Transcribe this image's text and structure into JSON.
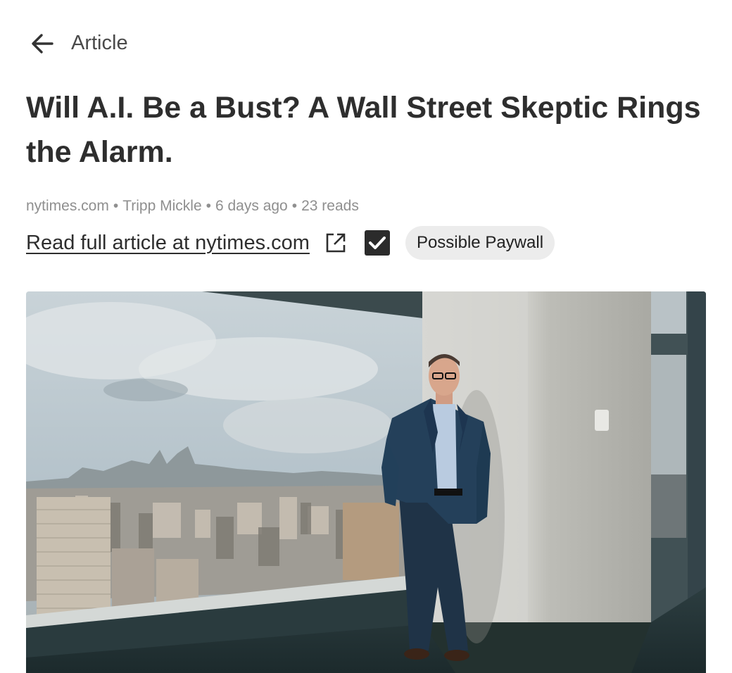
{
  "topbar": {
    "back_icon": "arrow-left-icon",
    "title": "Article"
  },
  "article": {
    "title": "Will A.I. Be a Bust? A Wall Street Skeptic Rings the Alarm.",
    "meta": {
      "source": "nytimes.com",
      "author": "Tripp Mickle",
      "time": "6 days ago",
      "reads": "23 reads",
      "separator": "•"
    },
    "read_full_label": "Read full article at nytimes.com",
    "external_icon": "external-link-icon",
    "checkbox_checked": true,
    "paywall_label": "Possible Paywall",
    "image_description": "Man in a navy suit leaning against a white column beside a window overlooking the New York City skyline"
  },
  "colors": {
    "text": "#2e2e2e",
    "meta": "#8f8f8f",
    "badge_bg": "#ececec",
    "checkbox": "#2b2b2b"
  }
}
